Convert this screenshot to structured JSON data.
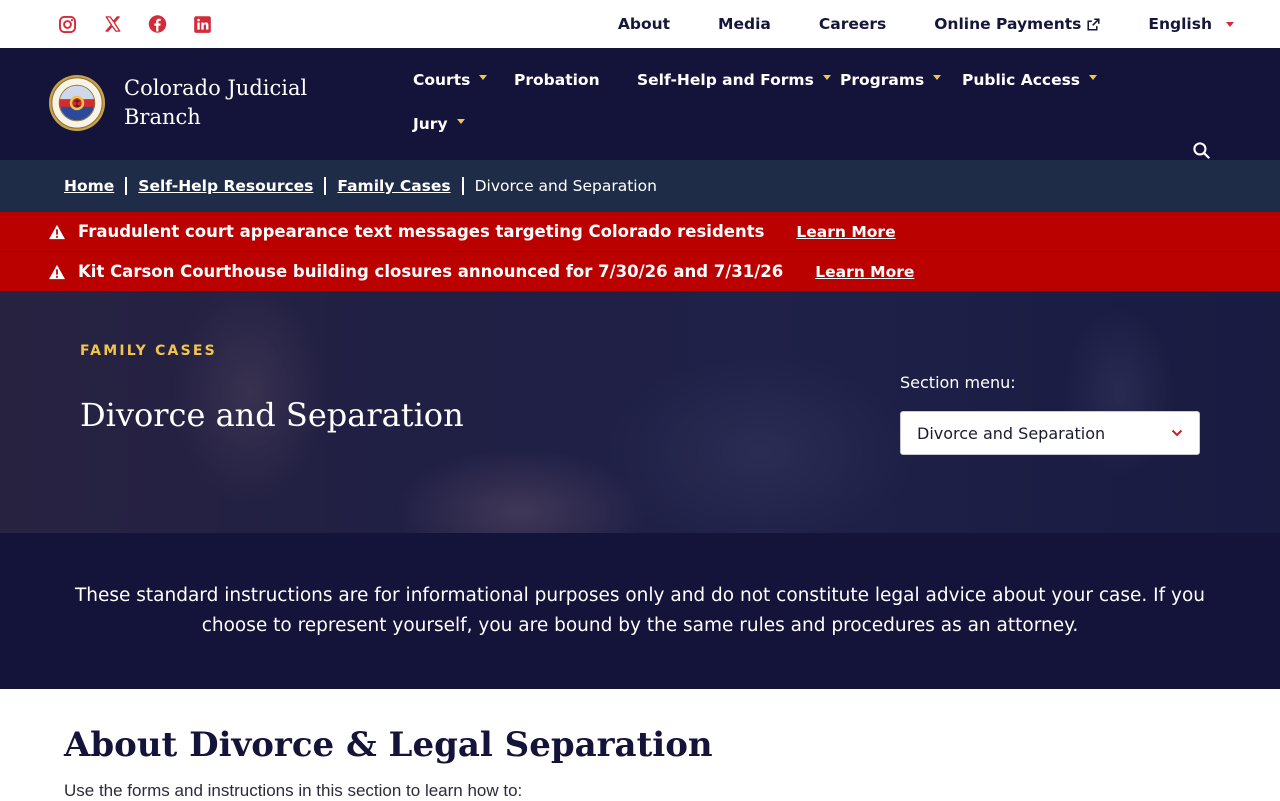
{
  "social": {
    "icons": [
      "instagram-icon",
      "x-icon",
      "facebook-icon",
      "linkedin-icon"
    ],
    "color": "#d22b3a"
  },
  "utility_nav": {
    "about": "About",
    "media": "Media",
    "careers": "Careers",
    "online_payments": "Online Payments",
    "language": "English"
  },
  "header": {
    "brand_name": "Colorado Judicial Branch",
    "nav": {
      "courts": "Courts",
      "probation": "Probation",
      "self_help": "Self-Help and Forms",
      "programs": "Programs",
      "public_access": "Public Access",
      "jury": "Jury"
    }
  },
  "breadcrumb": {
    "home": "Home",
    "self_help_resources": "Self-Help Resources",
    "family_cases": "Family Cases",
    "current": "Divorce and Separation"
  },
  "alerts": [
    {
      "message": "Fraudulent court appearance text messages targeting Colorado residents",
      "link": "Learn More"
    },
    {
      "message": "Kit Carson Courthouse building closures announced for 7/30/26 and 7/31/26",
      "link": "Learn More"
    }
  ],
  "hero": {
    "eyebrow": "FAMILY CASES",
    "title": "Divorce and Separation",
    "section_menu_label": "Section menu:",
    "section_menu_value": "Divorce and Separation"
  },
  "disclaimer": "These standard instructions are for informational purposes only and do not constitute legal advice about your case. If you choose to represent yourself, you are bound by the same rules and procedures as an attorney.",
  "content": {
    "heading": "About Divorce & Legal Separation",
    "intro": "Use the forms and instructions in this section to learn how to:"
  },
  "colors": {
    "navy": "#14133a",
    "breadcrumb_bg": "#1f2c48",
    "alert_red": "#bb0000",
    "gold": "#f2c44b"
  }
}
